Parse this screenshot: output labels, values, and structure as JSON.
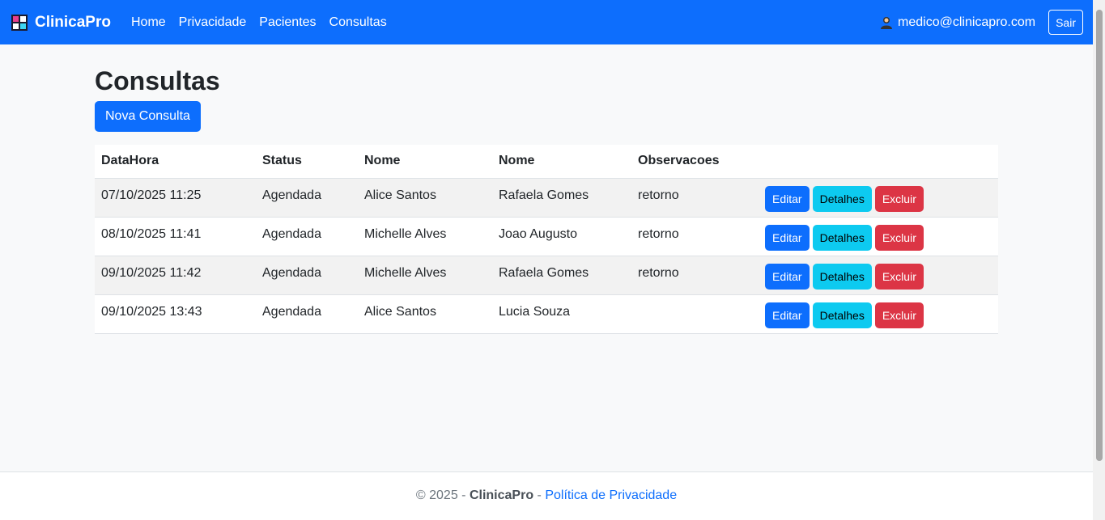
{
  "nav": {
    "brand": "ClinicaPro",
    "links": [
      "Home",
      "Privacidade",
      "Pacientes",
      "Consultas"
    ],
    "user_email": "medico@clinicapro.com",
    "logout_label": "Sair",
    "color": "#0d6efd"
  },
  "page": {
    "title": "Consultas",
    "new_button": "Nova Consulta"
  },
  "table": {
    "headers": [
      "DataHora",
      "Status",
      "Nome",
      "Nome",
      "Observacoes"
    ],
    "rows": [
      [
        "07/10/2025 11:25",
        "Agendada",
        "Alice Santos",
        "Rafaela Gomes",
        "retorno"
      ],
      [
        "08/10/2025 11:41",
        "Agendada",
        "Michelle Alves",
        "Joao Augusto",
        "retorno"
      ],
      [
        "09/10/2025 11:42",
        "Agendada",
        "Michelle Alves",
        "Rafaela Gomes",
        "retorno"
      ],
      [
        "09/10/2025 13:43",
        "Agendada",
        "Alice Santos",
        "Lucia Souza",
        ""
      ]
    ],
    "actions": {
      "edit": "Editar",
      "details": "Detalhes",
      "delete": "Excluir"
    }
  },
  "footer": {
    "copyright": "© 2025 -",
    "brand": "ClinicaPro",
    "separator": "-",
    "privacy_link": "Política de Privacidade"
  }
}
